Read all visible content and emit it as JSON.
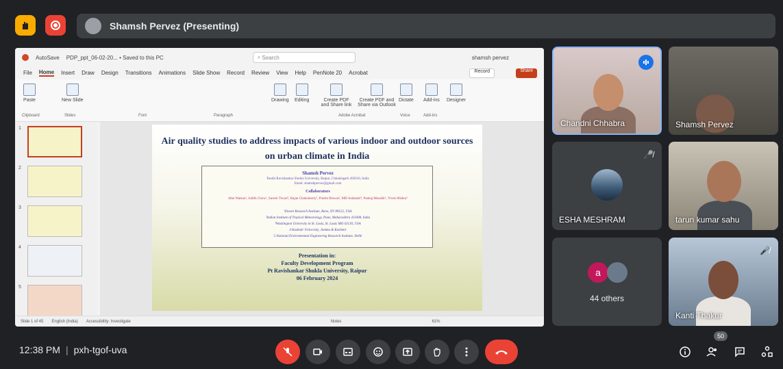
{
  "header": {
    "presenting_label": "Shamsh Pervez (Presenting)"
  },
  "ppt": {
    "autosave": "AutoSave",
    "filename": "PDP_ppt_06-02-20... • Saved to this PC",
    "search_placeholder": "Search",
    "user": "shamsh pervez",
    "tabs": [
      "File",
      "Home",
      "Insert",
      "Draw",
      "Design",
      "Transitions",
      "Animations",
      "Slide Show",
      "Record",
      "Review",
      "View",
      "Help",
      "PenNote 20",
      "Acrobat"
    ],
    "record_label": "Record",
    "share_label": "Share",
    "ribbon": {
      "paste": "Paste",
      "new_slide": "New Slide",
      "drawing": "Drawing",
      "editing": "Editing",
      "create_pdf": "Create PDF and Share link",
      "create_pdf_outlook": "Create PDF and Share via Outlook",
      "dictate": "Dictate",
      "addins": "Add-ins",
      "designer": "Designer",
      "groups": [
        "Clipboard",
        "Slides",
        "Font",
        "Paragraph",
        "Adobe Acrobat",
        "Voice",
        "Add-ins"
      ]
    },
    "thumb_numbers": [
      "1",
      "2",
      "3",
      "4",
      "5"
    ],
    "status": {
      "slide": "Slide 1 of 45",
      "lang": "English (India)",
      "accessibility": "Accessibility: Investigate",
      "notes": "Notes",
      "zoom": "61%"
    }
  },
  "slide": {
    "title": "Air quality studies to address impacts of various indoor and outdoor sources on urban climate in India",
    "presenter": "Shamsh Pervez",
    "affiliation1": "Pandit Ravishankar Shukla University, Raipur, Chhattisgarh 492010, India",
    "email": "Email: shamshpervez@gmail.com",
    "collab_heading": "Collaborators",
    "authors": "John Watson¹, Judith Chow¹, Suresh Tiwari², Rajan Chakraborty³, Pratim Biswas³, MH Andarabi⁴, Pankaj Mosalik⁵, Vivek Mishra⁵",
    "affils": [
      "¹Desert Research Institute, Reno, NV 89512, USA",
      "²Indian Institute of Tropical Meteorology, Pune, Maharashtra 411008, India",
      "³Washington University in St. Louis, St. Louis MO 63130, USA",
      "4 Kashmir University, Jammu & Kashmir",
      "5 National Environmental Engineering Research Institute, Delhi"
    ],
    "pres_in": "Presentation in:",
    "program": "Faculty Development Program",
    "university": "Pt Ravishankar Shukla University, Raipur",
    "date": "06 February 2024"
  },
  "participants": {
    "p1": "Chandni Chhabra",
    "p2": "Shamsh Pervez",
    "p3": "ESHA MESHRAM",
    "p4": "tarun kumar sahu",
    "p5_avatar_letter": "a",
    "p5": "44 others",
    "p6": "Kanti Thakur"
  },
  "bottom": {
    "time": "12:38 PM",
    "meeting_code": "pxh-tgof-uva",
    "people_count": "50"
  },
  "colors": {
    "accent": "#1a73e8",
    "danger": "#ea4335",
    "surface": "#3c4043",
    "bg": "#202124"
  }
}
